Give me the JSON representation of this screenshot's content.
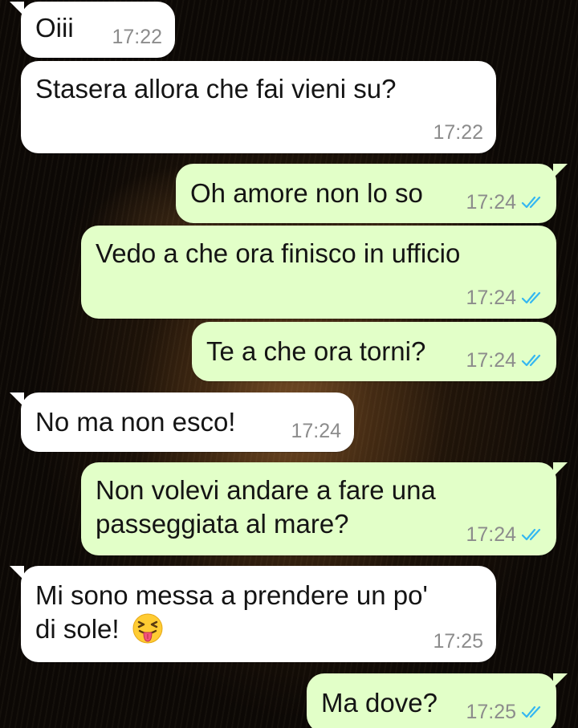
{
  "chat": {
    "messages": [
      {
        "direction": "incoming",
        "text": "Oiii",
        "time": "17:22"
      },
      {
        "direction": "incoming",
        "text": "Stasera allora che fai vieni su?",
        "time": "17:22"
      },
      {
        "direction": "outgoing",
        "text": "Oh amore non lo so",
        "time": "17:24",
        "status": "read"
      },
      {
        "direction": "outgoing",
        "text": "Vedo a che ora finisco in ufficio",
        "time": "17:24",
        "status": "read"
      },
      {
        "direction": "outgoing",
        "text": "Te a che ora torni?",
        "time": "17:24",
        "status": "read"
      },
      {
        "direction": "incoming",
        "text": "No ma non esco!",
        "time": "17:24"
      },
      {
        "direction": "outgoing",
        "text": "Non volevi andare a fare una passeggiata al mare?",
        "time": "17:24",
        "status": "read"
      },
      {
        "direction": "incoming",
        "text": "Mi sono messa a prendere un po' di sole!",
        "emoji": "squinting-face-with-tongue",
        "time": "17:25"
      },
      {
        "direction": "outgoing",
        "text": "Ma dove?",
        "time": "17:25",
        "status": "read"
      }
    ]
  },
  "colors": {
    "incoming_bubble": "#ffffff",
    "outgoing_bubble": "#e2ffc8",
    "read_ticks": "#34b7f1",
    "timestamp": "#8c8c8c"
  },
  "wallpaper": "lion-face-dark"
}
